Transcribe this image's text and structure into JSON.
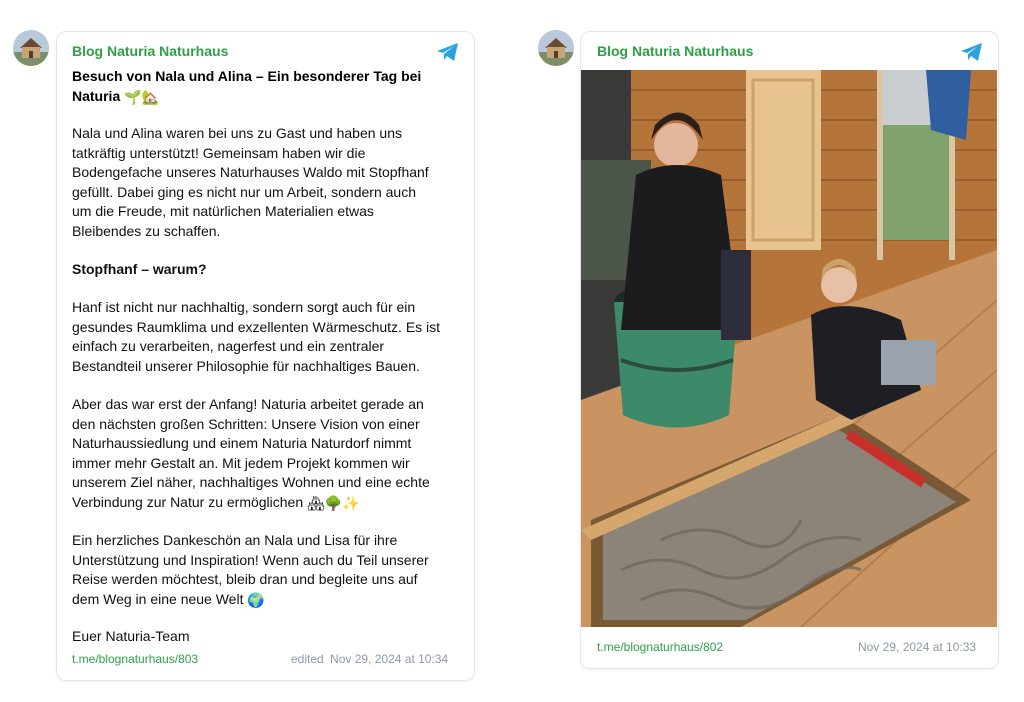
{
  "post1": {
    "channel": "Blog Naturia Naturhaus",
    "title_lines": [
      "Besuch von Nala und Alina – Ein besonderer Tag bei",
      "Naturia"
    ],
    "title_emoji": "🌱🏡",
    "paragraphs": [
      [
        "Nala und Alina waren bei uns zu Gast und haben uns",
        "tatkräftig unterstützt! Gemeinsam haben wir die",
        "Bodengefache unseres Naturhauses Waldo mit Stopfhanf",
        "gefüllt.  Dabei ging es nicht nur um Arbeit, sondern auch",
        "um die Freude, mit natürlichen Materialien etwas",
        "Bleibendes zu schaffen."
      ],
      [
        "Stopfhanf – warum?"
      ],
      [
        "Hanf ist nicht nur nachhaltig, sondern sorgt auch für ein",
        "gesundes Raumklima und exzellenten Wärmeschutz. Es ist",
        "einfach zu verarbeiten, nagerfest und ein zentraler",
        "Bestandteil unserer Philosophie für nachhaltiges Bauen."
      ],
      [
        "Aber das war erst der Anfang! Naturia arbeitet gerade an",
        "den nächsten großen Schritten: Unsere Vision von einer",
        "Naturhaussiedlung und einem Naturia Naturdorf nimmt",
        "immer mehr Gestalt an. Mit jedem Projekt kommen wir",
        "unserem Ziel näher, nachhaltiges Wohnen und eine echte",
        "Verbindung zur Natur zu ermöglichen"
      ],
      [
        "Ein herzliches Dankeschön an Nala und Lisa für ihre",
        "Unterstützung und Inspiration! Wenn auch du Teil unserer",
        "Reise werden möchtest, bleib dran und begleite uns auf",
        "dem Weg in eine neue Welt"
      ],
      [
        "Euer Naturia-Team"
      ]
    ],
    "p4_emoji": "🏘🌳✨",
    "p5_emoji": "🌍",
    "link": "t.me/blognaturhaus/803",
    "edited_label": "edited",
    "date": "Nov 29, 2024 at 10:34"
  },
  "post2": {
    "channel": "Blog Naturia Naturhaus",
    "photo_icon": "photo-two-women-filling-floor-with-hemp",
    "link": "t.me/blognaturhaus/802",
    "date": "Nov 29, 2024 at 10:33"
  },
  "icons": {
    "channel_avatar": "house-avatar-icon",
    "telegram": "telegram-plane-icon"
  },
  "colors": {
    "accent_green": "#2ea044",
    "telegram_blue": "#2aa3e0",
    "meta_gray": "#8d99a6"
  }
}
